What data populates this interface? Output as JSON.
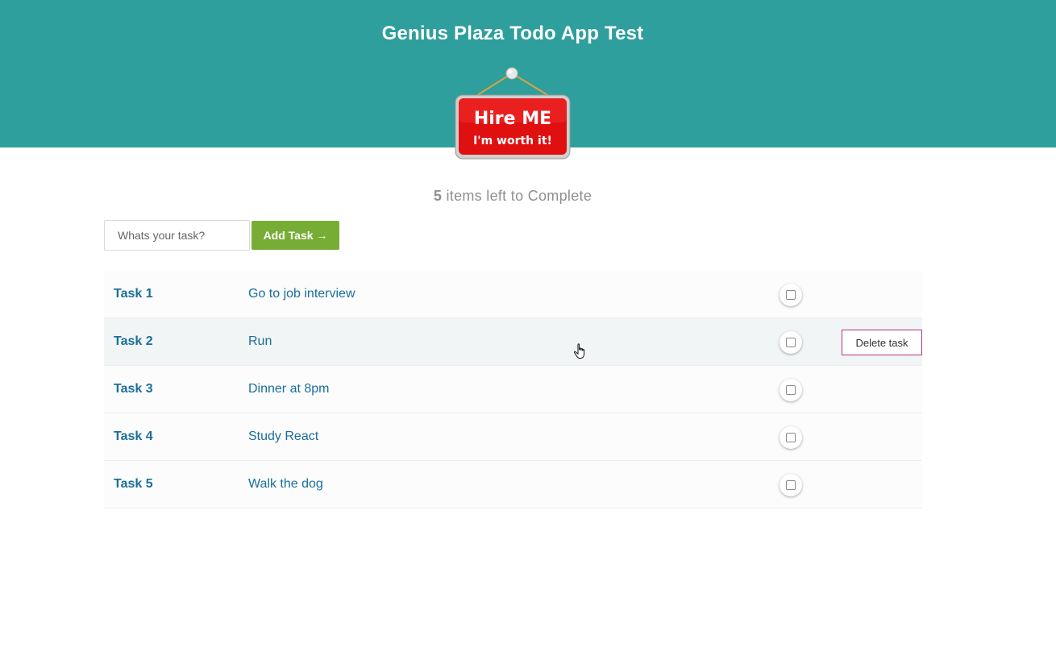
{
  "header": {
    "title": "Genius Plaza Todo App Test",
    "background": "#2e9f9c",
    "sign": {
      "line1": "Hire ME",
      "line2": "I'm worth it!"
    }
  },
  "counter": {
    "count": "5",
    "suffix": "items left to Complete"
  },
  "form": {
    "placeholder": "Whats your task?",
    "value": "",
    "add_label": "Add Task →",
    "add_color": "#78ad35"
  },
  "tasks": [
    {
      "name": "Task 1",
      "description": "Go to job interview",
      "completed": false
    },
    {
      "name": "Task 2",
      "description": "Run",
      "completed": false,
      "delete_label": "Delete task"
    },
    {
      "name": "Task 3",
      "description": "Dinner at 8pm",
      "completed": false
    },
    {
      "name": "Task 4",
      "description": "Study React",
      "completed": false
    },
    {
      "name": "Task 5",
      "description": "Walk the dog",
      "completed": false
    }
  ],
  "colors": {
    "task_text": "#1a6e9a",
    "delete_border": "#b3338a"
  }
}
